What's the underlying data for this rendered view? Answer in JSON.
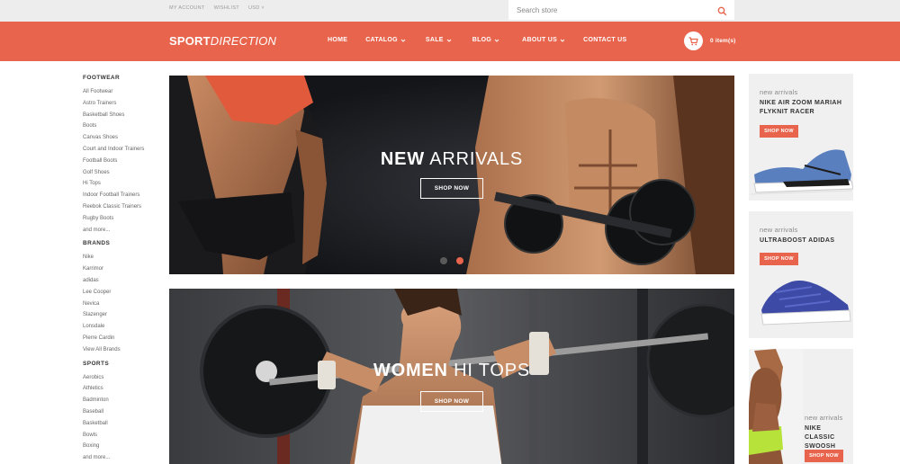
{
  "colors": {
    "accent": "#e8644c",
    "topbar_bg": "#ededed",
    "promo_bg": "#f0f0f0",
    "dot_inactive": "#5a5a5a"
  },
  "topbar": {
    "links": [
      "MY ACCOUNT",
      "WISHLIST",
      "USD"
    ],
    "search_placeholder": "Search store",
    "search_icon": "search-icon"
  },
  "header": {
    "logo_part1": "SPORT",
    "logo_part2": "DIRECTION",
    "nav": [
      {
        "label": "HOME",
        "dropdown": false
      },
      {
        "label": "CATALOG",
        "dropdown": true
      },
      {
        "label": "SALE",
        "dropdown": true
      },
      {
        "label": "BLOG",
        "dropdown": true
      },
      {
        "label": "ABOUT US",
        "dropdown": true
      },
      {
        "label": "CONTACT US",
        "dropdown": false
      }
    ],
    "cart_icon": "shopping-cart-icon",
    "cart_label": "0  item(s)"
  },
  "sidebar": {
    "footwear": {
      "title": "FOOTWEAR",
      "items": [
        "All Footwear",
        "Astro Trainers",
        "Basketball Shoes",
        "Boots",
        "Canvas Shoes",
        "Court and Indoor Trainers",
        "Football Boots",
        "Golf Shoes",
        "Hi Tops",
        "Indoor Football Trainers",
        "Reebok Classic Trainers",
        "Rugby Boots",
        "and more..."
      ]
    },
    "brands": {
      "title": "BRANDS",
      "items": [
        "Nike",
        "Karrimor",
        "adidas",
        "Lee Cooper",
        "Nevica",
        "Slazenger",
        "Lonsdale",
        "Pierre Cardin",
        "View All Brands"
      ]
    },
    "sports": {
      "title": "SPORTS",
      "items": [
        "Aerobics",
        "Athletics",
        "Badminton",
        "Baseball",
        "Basketball",
        "Bowls",
        "Boxing",
        "and more..."
      ]
    }
  },
  "hero1": {
    "title_bold": "NEW",
    "title_rest": " ARRIVALS",
    "button": "SHOP NOW",
    "slides": 2,
    "active_slide": 2
  },
  "hero2": {
    "title_bold": "WOMEN",
    "title_rest": " HI TOPS",
    "button": "SHOP NOW"
  },
  "promos": [
    {
      "kicker": "new arrivals",
      "name_line1": "NIKE AIR ZOOM MARIAH",
      "name_line2": "FLYKNIT RACER",
      "button": "SHOP NOW"
    },
    {
      "kicker": "new arrivals",
      "name_line1": "ULTRABOOST ADIDAS",
      "name_line2": "",
      "button": "SHOP NOW"
    },
    {
      "kicker": "new arrivals",
      "name_line1": "NIKE CLASSIC",
      "name_line2": "SWOOSH COOLING",
      "button": "SHOP NOW"
    }
  ]
}
